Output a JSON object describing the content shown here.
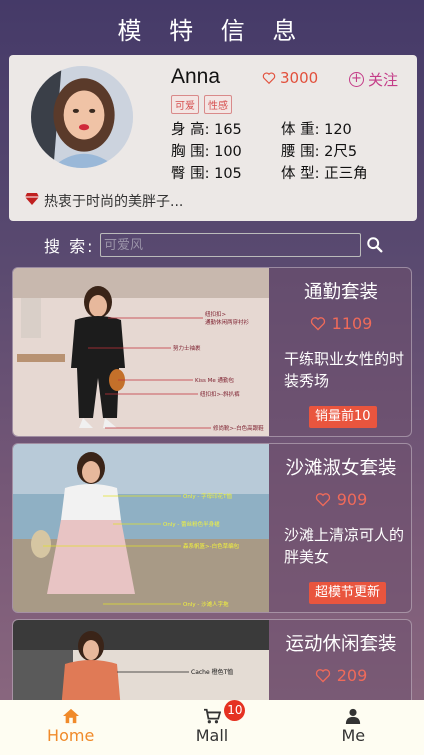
{
  "header": {
    "title": "模 特 信 息"
  },
  "profile": {
    "name": "Anna",
    "likes": "3000",
    "follow_label": "关注",
    "tags": [
      "可爱",
      "性感"
    ],
    "stats": [
      {
        "label": "身 高:",
        "value": "165"
      },
      {
        "label": "体 重:",
        "value": "120"
      },
      {
        "label": "胸 围:",
        "value": "100"
      },
      {
        "label": "腰 围:",
        "value": "2尺5"
      },
      {
        "label": "臀 围:",
        "value": "105"
      },
      {
        "label": "体 型:",
        "value": "正三角"
      }
    ],
    "motto": "热衷于时尚的美胖子..."
  },
  "search": {
    "label": "搜 索:",
    "placeholder": "可爱风"
  },
  "cards": [
    {
      "title": "通勤套装",
      "likes": "1109",
      "desc": "干练职业女性的时装秀场",
      "badge": "销量前10",
      "annotations": [
        "纽扣扣>",
        "通勤休闲两穿衬衫",
        "努力士袖裹",
        "Kiss Me 通勤包",
        "纽扣扣>-斜扒裤",
        "修尚靴>-白色高跟鞋"
      ]
    },
    {
      "title": "沙滩淑女套装",
      "likes": "909",
      "desc": "沙滩上清凉可人的胖美女",
      "badge": "超模节更新",
      "annotations": [
        "Only - 字母印花T恤",
        "Only - 蕾丝粉色半身裙",
        "森系帆篮>-白色草编包",
        "Only - 沙滩人字拖"
      ]
    },
    {
      "title": "运动休闲套装",
      "likes": "209",
      "desc": "",
      "badge": "",
      "annotations": [
        "Cache 橙色T恤"
      ]
    }
  ],
  "nav": {
    "items": [
      {
        "label": "Home",
        "icon": "home-icon"
      },
      {
        "label": "Mall",
        "icon": "cart-icon"
      },
      {
        "label": "Me",
        "icon": "user-icon"
      }
    ],
    "cart_count": "10"
  },
  "colors": {
    "accent": "#f08a2a",
    "like": "#e2503c",
    "badge": "#e9553e",
    "follow": "#c43c88"
  }
}
